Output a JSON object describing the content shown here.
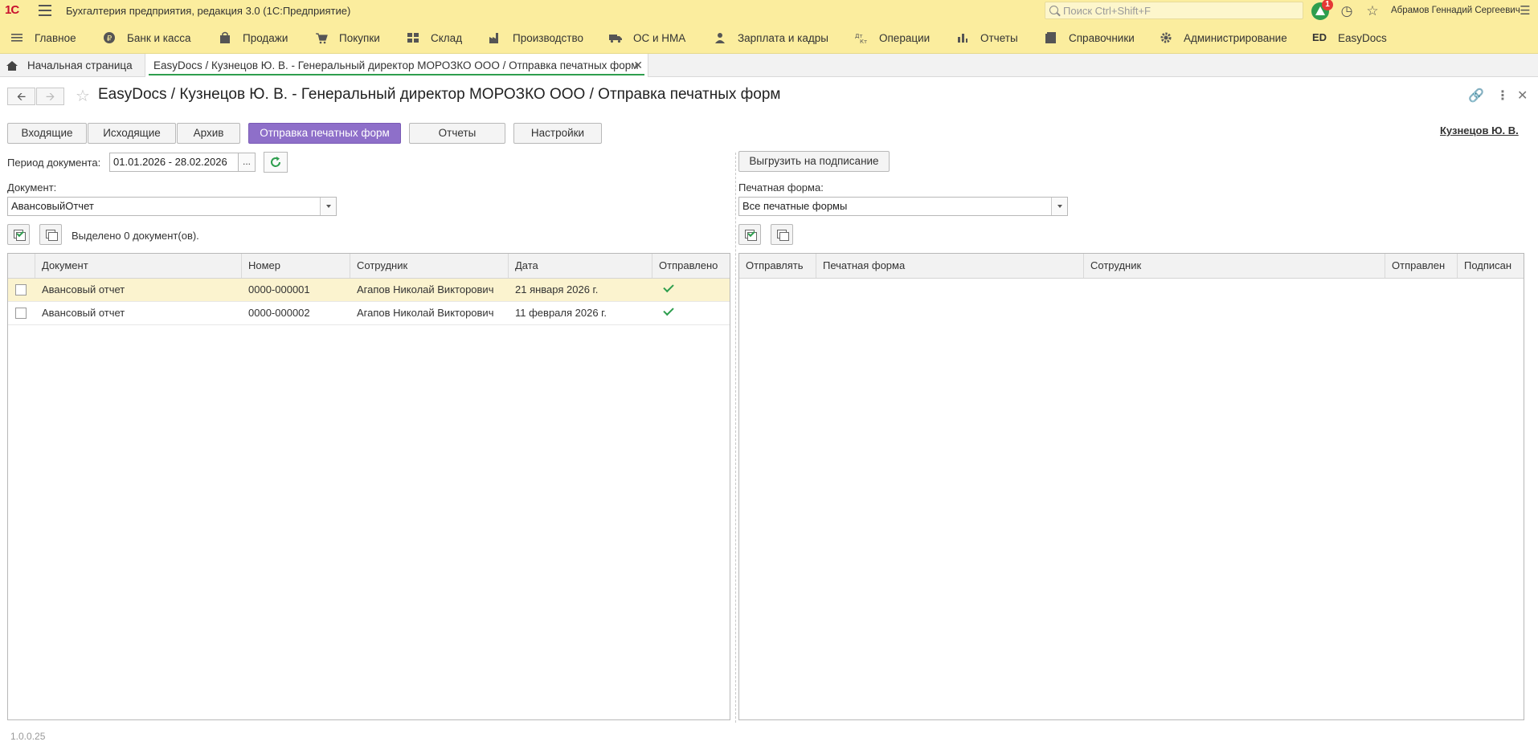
{
  "app": {
    "logo": "1С",
    "title": "Бухгалтерия предприятия, редакция 3.0  (1С:Предприятие)",
    "search_placeholder": "Поиск Ctrl+Shift+F",
    "notification_count": "1",
    "user": "Абрамов Геннадий Сергеевич"
  },
  "sections": [
    {
      "label": "Главное",
      "icon": "menu-icon"
    },
    {
      "label": "Банк и касса",
      "icon": "ruble-icon"
    },
    {
      "label": "Продажи",
      "icon": "shopping-bag-icon"
    },
    {
      "label": "Покупки",
      "icon": "cart-icon"
    },
    {
      "label": "Склад",
      "icon": "warehouse-icon"
    },
    {
      "label": "Производство",
      "icon": "factory-icon"
    },
    {
      "label": "ОС и НМА",
      "icon": "truck-icon"
    },
    {
      "label": "Зарплата и кадры",
      "icon": "person-icon"
    },
    {
      "label": "Операции",
      "icon": "dt-kt-icon"
    },
    {
      "label": "Отчеты",
      "icon": "bar-chart-icon"
    },
    {
      "label": "Справочники",
      "icon": "book-icon"
    },
    {
      "label": "Администрирование",
      "icon": "gear-icon"
    },
    {
      "label": "EasyDocs",
      "icon": "ed-icon"
    }
  ],
  "tabs": {
    "home": "Начальная страница",
    "active": "EasyDocs / Кузнецов Ю. В. - Генеральный директор МОРОЗКО ООО / Отправка печатных форм"
  },
  "form": {
    "title": "EasyDocs / Кузнецов Ю. В. - Генеральный директор МОРОЗКО ООО / Отправка печатных форм",
    "user_link": "Кузнецов Ю. В.",
    "buttons": {
      "incoming": "Входящие",
      "outgoing": "Исходящие",
      "archive": "Архив",
      "send_print_forms": "Отправка печатных форм",
      "reports": "Отчеты",
      "settings": "Настройки"
    },
    "period_label": "Период документа:",
    "period_value": "01.01.2026 - 28.02.2026",
    "period_btn": "...",
    "document_label": "Документ:",
    "document_value": "АвансовыйОтчет",
    "selected_text": "Выделено 0 документ(ов).",
    "upload_button": "Выгрузить на подписание",
    "print_form_label": "Печатная форма:",
    "print_form_value": "Все печатные формы"
  },
  "left_table": {
    "columns": [
      "Документ",
      "Номер",
      "Сотрудник",
      "Дата",
      "Отправлено"
    ],
    "rows": [
      {
        "document": "Авансовый отчет",
        "number": "0000-000001",
        "employee": "Агапов Николай Викторович",
        "date": "21 января 2026 г.",
        "sent": true,
        "checked": false
      },
      {
        "document": "Авансовый отчет",
        "number": "0000-000002",
        "employee": "Агапов Николай Викторович",
        "date": "11 февраля 2026 г.",
        "sent": true,
        "checked": false
      }
    ]
  },
  "right_table": {
    "columns": [
      "Отправлять",
      "Печатная форма",
      "Сотрудник",
      "Отправлен",
      "Подписан"
    ],
    "rows": []
  },
  "version": "1.0.0.25",
  "colors": {
    "header_bg": "#fbed9e",
    "accent_purple": "#8e6fc9",
    "green": "#2e9e4e",
    "selected_row": "#fbf3cf"
  }
}
